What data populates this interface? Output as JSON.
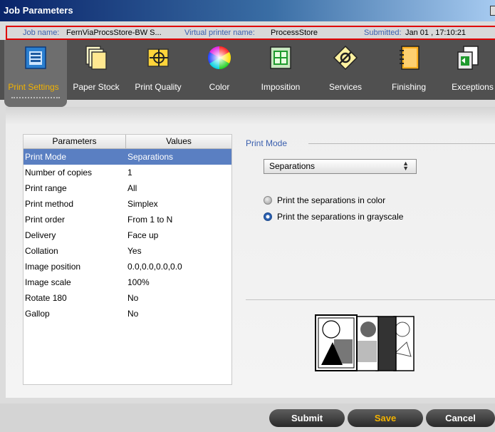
{
  "window": {
    "title": "Job Parameters"
  },
  "info": {
    "job_name_label": "Job name:",
    "job_name": "FernViaProcsStore-BW S...",
    "printer_label": "Virtual printer name:",
    "printer": "ProcessStore",
    "submitted_label": "Submitted:",
    "submitted": "Jan 01 , 17:10:21"
  },
  "toolbar": [
    {
      "label": "Print Settings",
      "icon": "print-settings-icon",
      "active": true
    },
    {
      "label": "Paper Stock",
      "icon": "paper-stock-icon"
    },
    {
      "label": "Print Quality",
      "icon": "print-quality-icon"
    },
    {
      "label": "Color",
      "icon": "color-wheel-icon"
    },
    {
      "label": "Imposition",
      "icon": "imposition-icon"
    },
    {
      "label": "Services",
      "icon": "services-icon"
    },
    {
      "label": "Finishing",
      "icon": "finishing-icon"
    },
    {
      "label": "Exceptions",
      "icon": "exceptions-icon"
    }
  ],
  "table": {
    "headers": [
      "Parameters",
      "Values"
    ],
    "rows": [
      [
        "Print Mode",
        "Separations"
      ],
      [
        "Number of copies",
        "1"
      ],
      [
        "Print range",
        "All"
      ],
      [
        "Print method",
        "Simplex"
      ],
      [
        "Print order",
        "From 1 to N"
      ],
      [
        "Delivery",
        "Face up"
      ],
      [
        "Collation",
        "Yes"
      ],
      [
        "Image position",
        "0.0,0.0,0.0,0.0"
      ],
      [
        "Image scale",
        "100%"
      ],
      [
        "Rotate 180",
        "No"
      ],
      [
        "Gallop",
        "No"
      ]
    ],
    "selected_row": 0
  },
  "print_mode": {
    "label": "Print Mode",
    "selected": "Separations",
    "options": [
      {
        "label": "Print the separations in color",
        "checked": false
      },
      {
        "label": "Print the separations in grayscale",
        "checked": true
      }
    ]
  },
  "buttons": {
    "submit": "Submit",
    "save": "Save",
    "cancel": "Cancel"
  },
  "colors": {
    "accent": "#f2b200",
    "selection": "#5a7fc2",
    "label_blue": "#3a5fae",
    "highlight_border": "#e00000"
  }
}
